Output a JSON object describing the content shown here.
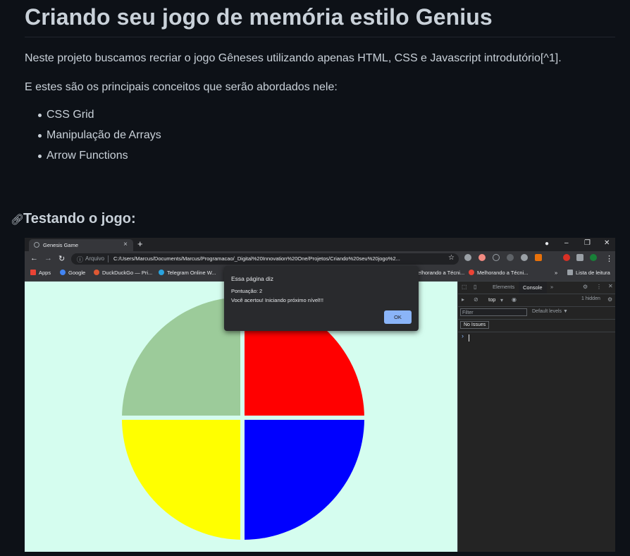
{
  "readme": {
    "title": "Criando seu jogo de memória estilo Genius",
    "intro": "Neste projeto buscamos recriar o jogo Gêneses utilizando apenas HTML, CSS e Javascript introdutório[^1].",
    "concepts_intro": "E estes são os principais conceitos que serão abordados nele:",
    "concepts": [
      "CSS Grid",
      "Manipulação de Arrays",
      "Arrow Functions"
    ],
    "section_heading": "Testando o jogo:"
  },
  "browser": {
    "tab_title": "Genesis Game",
    "tab_close": "×",
    "new_tab": "+",
    "window_buttons": [
      "–",
      "❐",
      "✕"
    ],
    "address_prefix": "Arquivo",
    "address_path": "C:/Users/Marcus/Documents/Marcus/Programacao/_Digital%20Innovation%20One/Projetos/Criando%20seu%20jogo%2...",
    "bookmarks": [
      "Apps",
      "Google",
      "DuckDuckGo — Pri...",
      "Telegram Online W...",
      "elhorando a Técni...",
      "Melhorando a Técni...",
      "»",
      "Lista de leitura"
    ]
  },
  "game": {
    "colors": {
      "green": "#9ccb9a",
      "red": "#ff0000",
      "yellow": "#ffff00",
      "blue": "#0000ff",
      "background": "#d5fdef"
    }
  },
  "dialog": {
    "title": "Essa página diz",
    "line1": "Pontuação: 2",
    "line2": "Você acertou! Iniciando próximo nível!!!",
    "ok_label": "OK"
  },
  "devtools": {
    "tabs": [
      "Elements",
      "Console",
      "»"
    ],
    "context": "top",
    "hidden": "1 hidden",
    "filter_placeholder": "Filter",
    "levels": "Default levels ▼",
    "issues": "No Issues",
    "prompt": "›"
  }
}
